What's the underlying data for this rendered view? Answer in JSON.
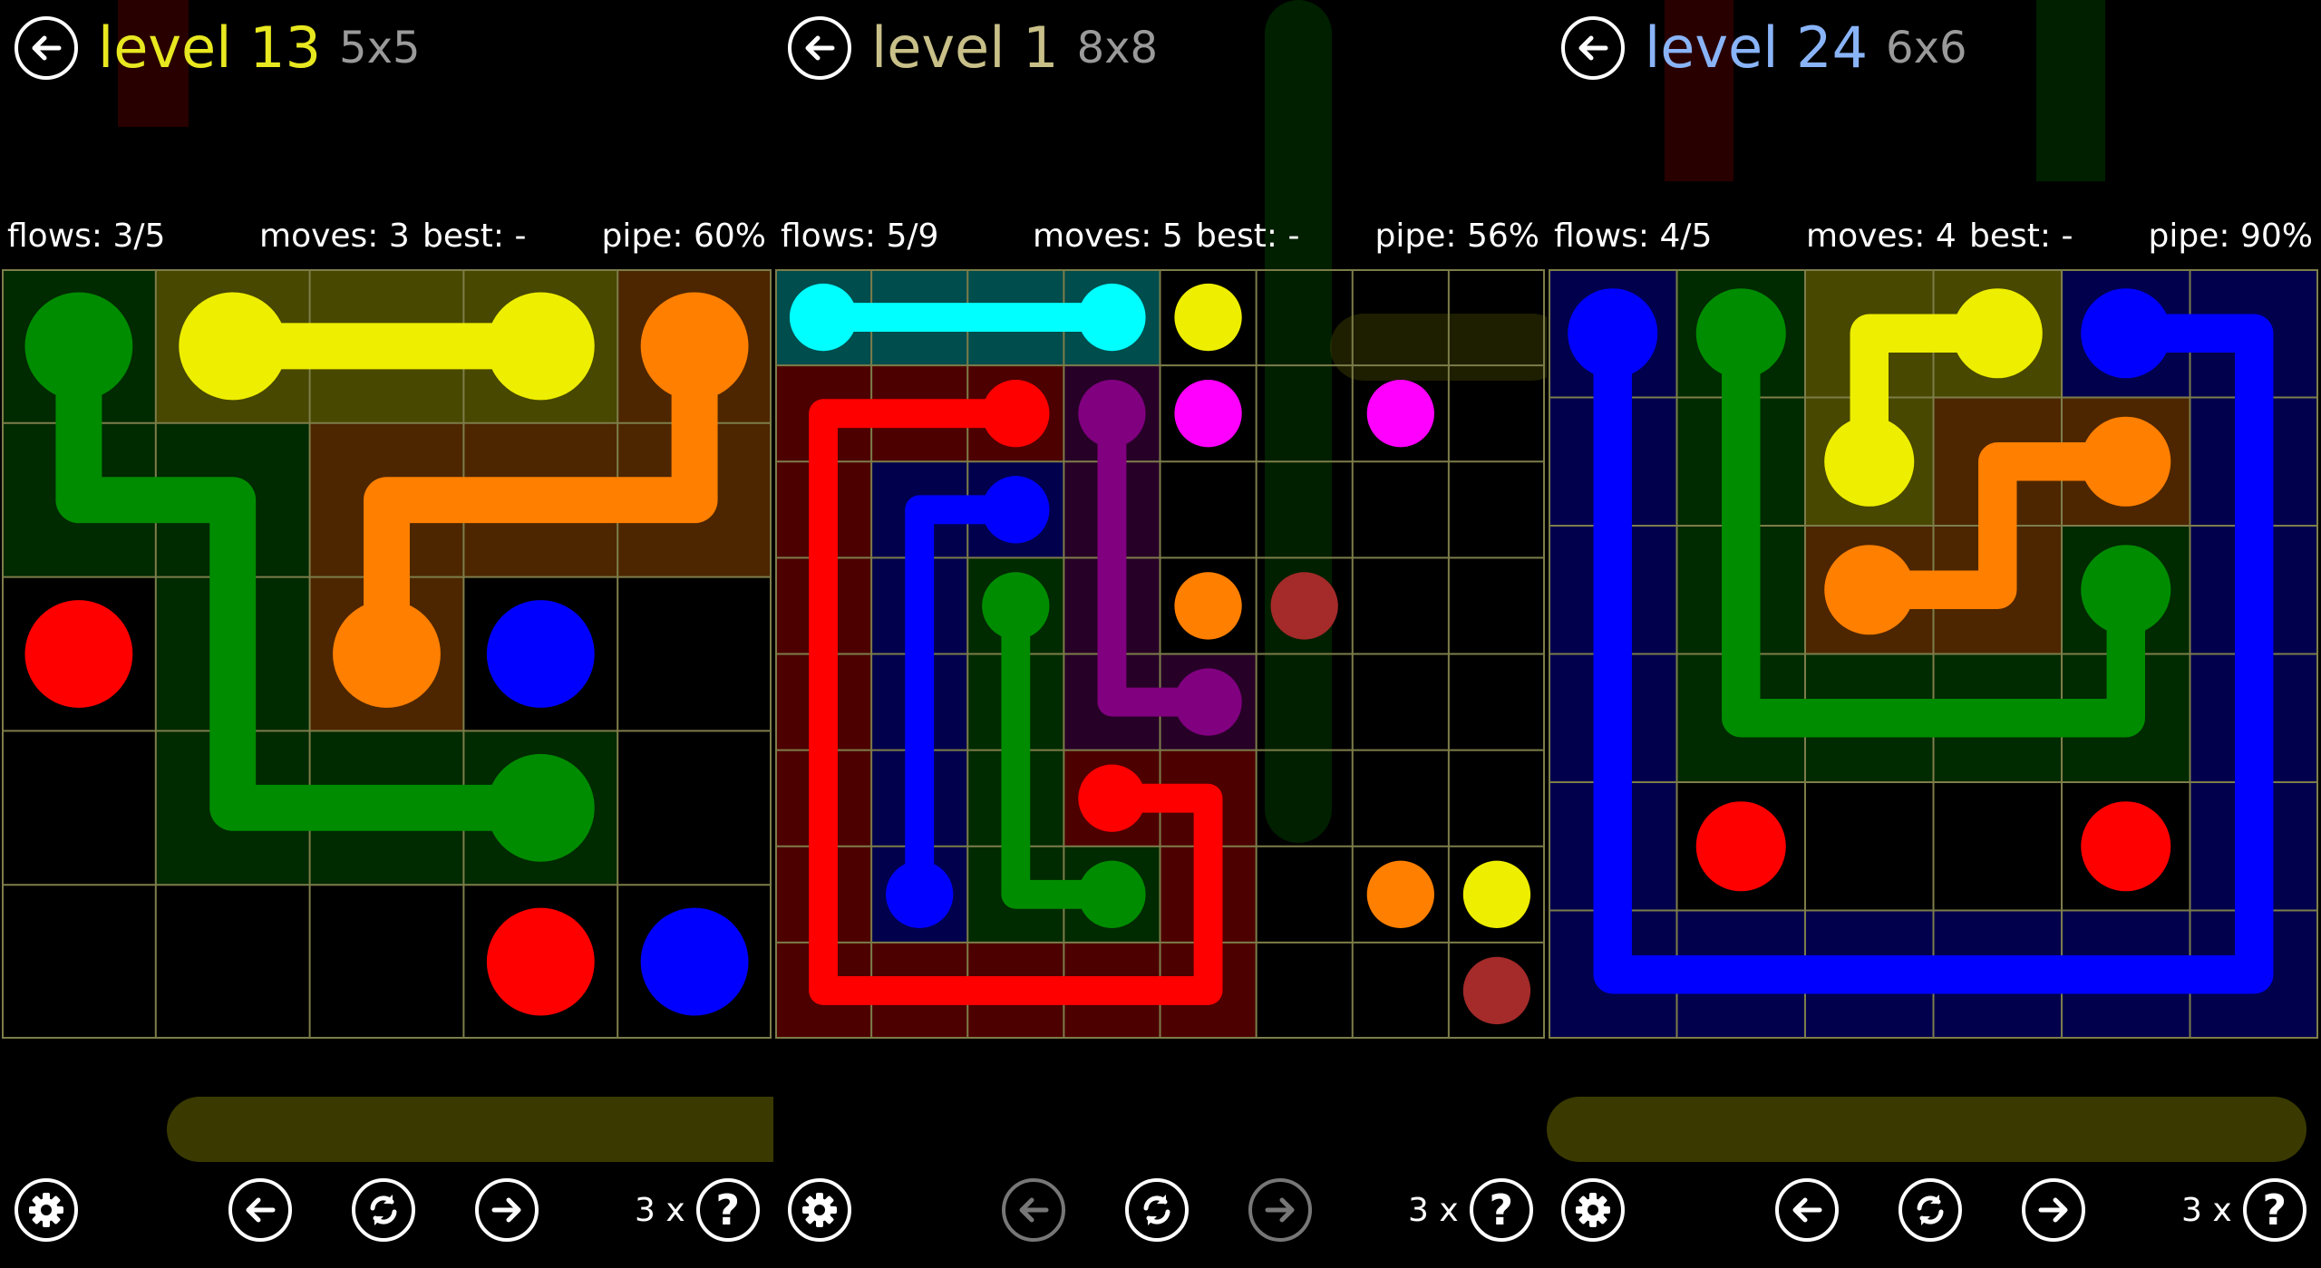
{
  "colors": {
    "red": "#ff0000",
    "green": "#008c00",
    "blue": "#0000ff",
    "yellow": "#eeee00",
    "orange": "#ff7f00",
    "cyan": "#00ffff",
    "magenta": "#ff00ff",
    "purple": "#800080",
    "maroon": "#a52a2a",
    "grid_line": "#7d7d4a",
    "level_yellow": "#e8e820",
    "level_khaki": "#c8c088",
    "level_blue": "#8ab4f8",
    "size_gray": "#9a9a9a"
  },
  "panels": [
    {
      "title": "level 13",
      "size_label": "5x5",
      "title_color": "#e8e820",
      "flows": "flows: 3/5",
      "moves": "moves: 3",
      "best": "best: -",
      "pipe": "pipe: 60%",
      "hint_count": "3 x",
      "hint_symbol": "?",
      "grid": {
        "rows": 5,
        "cols": 5
      },
      "endpoints": [
        {
          "color": "green",
          "r": 0,
          "c": 0
        },
        {
          "color": "yellow",
          "r": 0,
          "c": 1
        },
        {
          "color": "yellow",
          "r": 0,
          "c": 3
        },
        {
          "color": "orange",
          "r": 0,
          "c": 4
        },
        {
          "color": "red",
          "r": 2,
          "c": 0
        },
        {
          "color": "orange",
          "r": 2,
          "c": 2
        },
        {
          "color": "blue",
          "r": 2,
          "c": 3
        },
        {
          "color": "green",
          "r": 3,
          "c": 3
        },
        {
          "color": "red",
          "r": 4,
          "c": 3
        },
        {
          "color": "blue",
          "r": 4,
          "c": 4
        }
      ],
      "pipes": [
        {
          "color": "green",
          "cells": [
            [
              0,
              0
            ],
            [
              1,
              0
            ],
            [
              1,
              1
            ],
            [
              2,
              1
            ],
            [
              3,
              1
            ],
            [
              3,
              2
            ],
            [
              3,
              3
            ]
          ]
        },
        {
          "color": "yellow",
          "cells": [
            [
              0,
              1
            ],
            [
              0,
              2
            ],
            [
              0,
              3
            ]
          ]
        },
        {
          "color": "orange",
          "cells": [
            [
              0,
              4
            ],
            [
              1,
              4
            ],
            [
              1,
              3
            ],
            [
              1,
              2
            ],
            [
              2,
              2
            ]
          ]
        }
      ],
      "nav": {
        "prev_enabled": true,
        "next_enabled": true
      }
    },
    {
      "title": "level 1",
      "size_label": "8x8",
      "title_color": "#c8c088",
      "flows": "flows: 5/9",
      "moves": "moves: 5",
      "best": "best: -",
      "pipe": "pipe: 56%",
      "hint_count": "3 x",
      "hint_symbol": "?",
      "grid": {
        "rows": 8,
        "cols": 8
      },
      "endpoints": [
        {
          "color": "cyan",
          "r": 0,
          "c": 0
        },
        {
          "color": "cyan",
          "r": 0,
          "c": 3
        },
        {
          "color": "yellow",
          "r": 0,
          "c": 4
        },
        {
          "color": "red",
          "r": 1,
          "c": 2
        },
        {
          "color": "purple",
          "r": 1,
          "c": 3
        },
        {
          "color": "magenta",
          "r": 1,
          "c": 4
        },
        {
          "color": "magenta",
          "r": 1,
          "c": 6
        },
        {
          "color": "blue",
          "r": 2,
          "c": 2
        },
        {
          "color": "green",
          "r": 3,
          "c": 2
        },
        {
          "color": "orange",
          "r": 3,
          "c": 4
        },
        {
          "color": "maroon",
          "r": 3,
          "c": 5
        },
        {
          "color": "purple",
          "r": 4,
          "c": 4
        },
        {
          "color": "red",
          "r": 5,
          "c": 3
        },
        {
          "color": "blue",
          "r": 6,
          "c": 1
        },
        {
          "color": "green",
          "r": 6,
          "c": 3
        },
        {
          "color": "orange",
          "r": 6,
          "c": 6
        },
        {
          "color": "yellow",
          "r": 6,
          "c": 7
        },
        {
          "color": "maroon",
          "r": 7,
          "c": 7
        }
      ],
      "pipes": [
        {
          "color": "cyan",
          "cells": [
            [
              0,
              0
            ],
            [
              0,
              1
            ],
            [
              0,
              2
            ],
            [
              0,
              3
            ]
          ]
        },
        {
          "color": "red",
          "cells": [
            [
              1,
              2
            ],
            [
              1,
              1
            ],
            [
              1,
              0
            ],
            [
              2,
              0
            ],
            [
              3,
              0
            ],
            [
              4,
              0
            ],
            [
              5,
              0
            ],
            [
              6,
              0
            ],
            [
              7,
              0
            ],
            [
              7,
              1
            ],
            [
              7,
              2
            ],
            [
              7,
              3
            ],
            [
              7,
              4
            ],
            [
              6,
              4
            ],
            [
              5,
              4
            ],
            [
              5,
              3
            ]
          ]
        },
        {
          "color": "blue",
          "cells": [
            [
              2,
              2
            ],
            [
              2,
              1
            ],
            [
              3,
              1
            ],
            [
              4,
              1
            ],
            [
              5,
              1
            ],
            [
              6,
              1
            ]
          ]
        },
        {
          "color": "green",
          "cells": [
            [
              3,
              2
            ],
            [
              4,
              2
            ],
            [
              5,
              2
            ],
            [
              6,
              2
            ],
            [
              6,
              3
            ]
          ]
        },
        {
          "color": "purple",
          "cells": [
            [
              1,
              3
            ],
            [
              2,
              3
            ],
            [
              3,
              3
            ],
            [
              4,
              3
            ],
            [
              4,
              4
            ]
          ]
        }
      ],
      "nav": {
        "prev_enabled": false,
        "next_enabled": false
      }
    },
    {
      "title": "level 24",
      "size_label": "6x6",
      "title_color": "#8ab4f8",
      "flows": "flows: 4/5",
      "moves": "moves: 4",
      "best": "best: -",
      "pipe": "pipe: 90%",
      "hint_count": "3 x",
      "hint_symbol": "?",
      "grid": {
        "rows": 6,
        "cols": 6
      },
      "endpoints": [
        {
          "color": "blue",
          "r": 0,
          "c": 0
        },
        {
          "color": "green",
          "r": 0,
          "c": 1
        },
        {
          "color": "yellow",
          "r": 0,
          "c": 3
        },
        {
          "color": "blue",
          "r": 0,
          "c": 4
        },
        {
          "color": "yellow",
          "r": 1,
          "c": 2
        },
        {
          "color": "orange",
          "r": 1,
          "c": 4
        },
        {
          "color": "orange",
          "r": 2,
          "c": 2
        },
        {
          "color": "green",
          "r": 2,
          "c": 4
        },
        {
          "color": "red",
          "r": 4,
          "c": 1
        },
        {
          "color": "red",
          "r": 4,
          "c": 4
        }
      ],
      "pipes": [
        {
          "color": "blue",
          "cells": [
            [
              0,
              0
            ],
            [
              1,
              0
            ],
            [
              2,
              0
            ],
            [
              3,
              0
            ],
            [
              4,
              0
            ],
            [
              5,
              0
            ],
            [
              5,
              1
            ],
            [
              5,
              2
            ],
            [
              5,
              3
            ],
            [
              5,
              4
            ],
            [
              5,
              5
            ],
            [
              4,
              5
            ],
            [
              3,
              5
            ],
            [
              2,
              5
            ],
            [
              1,
              5
            ],
            [
              0,
              5
            ],
            [
              0,
              4
            ]
          ]
        },
        {
          "color": "green",
          "cells": [
            [
              0,
              1
            ],
            [
              1,
              1
            ],
            [
              2,
              1
            ],
            [
              3,
              1
            ],
            [
              3,
              2
            ],
            [
              3,
              3
            ],
            [
              3,
              4
            ],
            [
              2,
              4
            ]
          ]
        },
        {
          "color": "yellow",
          "cells": [
            [
              0,
              3
            ],
            [
              0,
              2
            ],
            [
              1,
              2
            ]
          ]
        },
        {
          "color": "orange",
          "cells": [
            [
              2,
              2
            ],
            [
              2,
              3
            ],
            [
              1,
              3
            ],
            [
              1,
              4
            ]
          ]
        }
      ],
      "nav": {
        "prev_enabled": true,
        "next_enabled": true
      }
    }
  ]
}
